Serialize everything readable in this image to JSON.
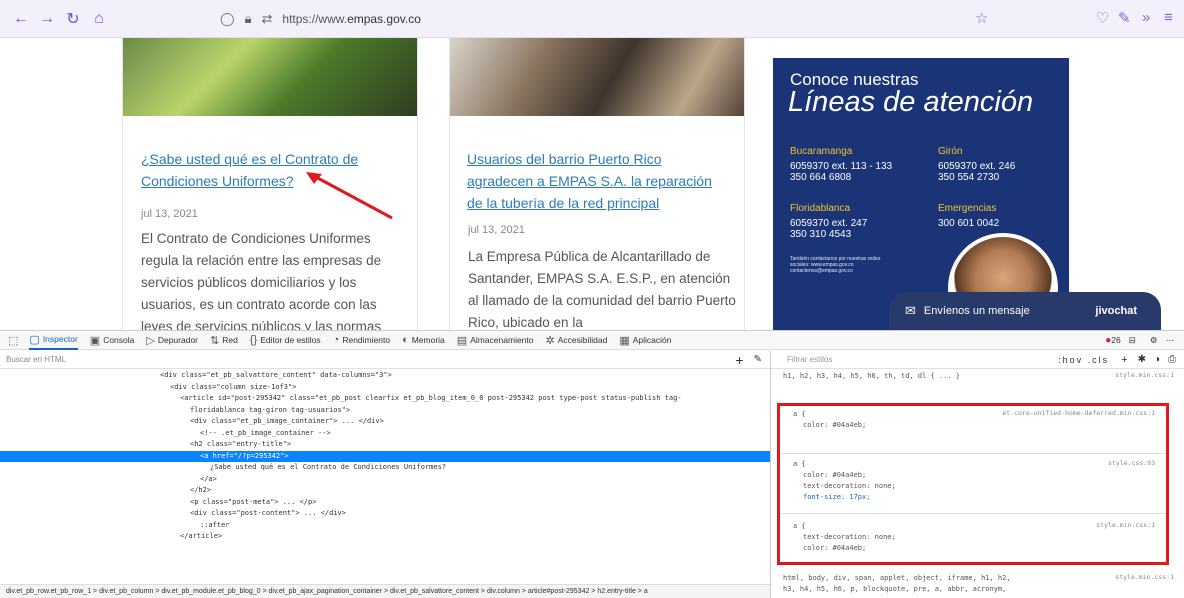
{
  "browser": {
    "url_prefix": "https://www.",
    "url_domain": "empas.gov.co"
  },
  "cards": [
    {
      "title": "¿Sabe usted qué es el Contrato de Condiciones Uniformes?",
      "date": "jul 13, 2021",
      "excerpt": "El Contrato de Condiciones Uniformes regula la relación entre las empresas de servicios públicos domiciliarios y los usuarios, es un contrato acorde con las leyes de servicios públicos y las normas"
    },
    {
      "title": "Usuarios del barrio Puerto Rico agradecen a EMPAS S.A. la reparación de la tubería de la red principal",
      "date": "jul 13, 2021",
      "excerpt": "La Empresa Pública de Alcantarillado de Santander, EMPAS S.A. E.S.P., en atención al llamado de la comunidad del barrio Puerto Rico, ubicado en la"
    }
  ],
  "banner": {
    "line1": "Conoce nuestras",
    "line2": "Líneas de atención",
    "cities": [
      {
        "name": "Bucaramanga",
        "phones": "6059370 ext. 113 - 133\n350 664 6808"
      },
      {
        "name": "Girón",
        "phones": "6059370 ext. 246\n350 554 2730"
      },
      {
        "name": "Floridablanca",
        "phones": "6059370 ext. 247\n350 310 4543"
      },
      {
        "name": "Emergencias",
        "phones": "300 601 0042"
      }
    ],
    "small_text": "También contáctanos por nuestras redes sociales: www.empas.gov.co contactenos@empas.gov.co"
  },
  "chat": {
    "label": "Envíenos un mensaje",
    "brand": "jivochat"
  },
  "devtools": {
    "tabs": [
      "Inspector",
      "Consola",
      "Depurador",
      "Red",
      "Editor de estilos",
      "Rendimiento",
      "Memoria",
      "Almacenamiento",
      "Accesibilidad",
      "Aplicación"
    ],
    "error_count": "26",
    "search_placeholder": "Buscar en HTML",
    "rules_filter": "Filtrar estilos",
    "rules_toggles": ":hov .cls",
    "html_lines": [
      "<div class=\"et_pb_salvattore_content\" data-columns=\"3\">",
      "<div class=\"column size-1of3\">",
      "<article id=\"post-295342\" class=\"et_pb_post clearfix et_pb_blog_item_0_0 post-295342 post type-post status-publish tag-",
      "floridablanca tag-giron tag-usuarios\">",
      "<div class=\"et_pb_image_container\"> ... </div>",
      "<!-- .et_pb_image_container -->",
      "<h2 class=\"entry-title\">",
      "<a href=\"/?p=295342\">",
      "¿Sabe usted qué es el Contrato de Condiciones Uniformes?",
      "</a>",
      "</h2>",
      "<p class=\"post-meta\"> ... </p>",
      "<div class=\"post-content\"> ... </div>",
      "::after",
      "</article>"
    ],
    "breadcrumb": "div.et_pb_row.et_pb_row_1 > div.et_pb_column > div.et_pb_module.et_pb_blog_0 > div.et_pb_ajax_pagination_container > div.et_pb_salvattore_content > div.column > article#post-295342 > h2.entry-title > a",
    "rules": {
      "top_line": "h1, h2, h3, h4, h5, h6, th, td, dl { ... }",
      "top_src": "style.min.css:1",
      "block1_head": "a {",
      "block1_src": "et-core-unified-home-deferred.min.css:1",
      "block1_props": [
        "color: #04a4eb;"
      ],
      "block2_head": "a {",
      "block2_src": "style.css:93",
      "block2_props": [
        "color: #04a4eb;",
        "text-decoration: none;",
        "font-size: 17px;"
      ],
      "block3_head": "a {",
      "block3_src": "style.min.css:1",
      "block3_props": [
        "text-decoration: none;",
        "color: #04a4eb;"
      ],
      "bottom_line1": "html, body, div, span, applet, object, iframe, h1, h2,",
      "bottom_line2": "h3, h4, h5, h6, p, blockquote, pre, a, abbr, acronym,",
      "bottom_src": "style.min.css:1"
    }
  }
}
